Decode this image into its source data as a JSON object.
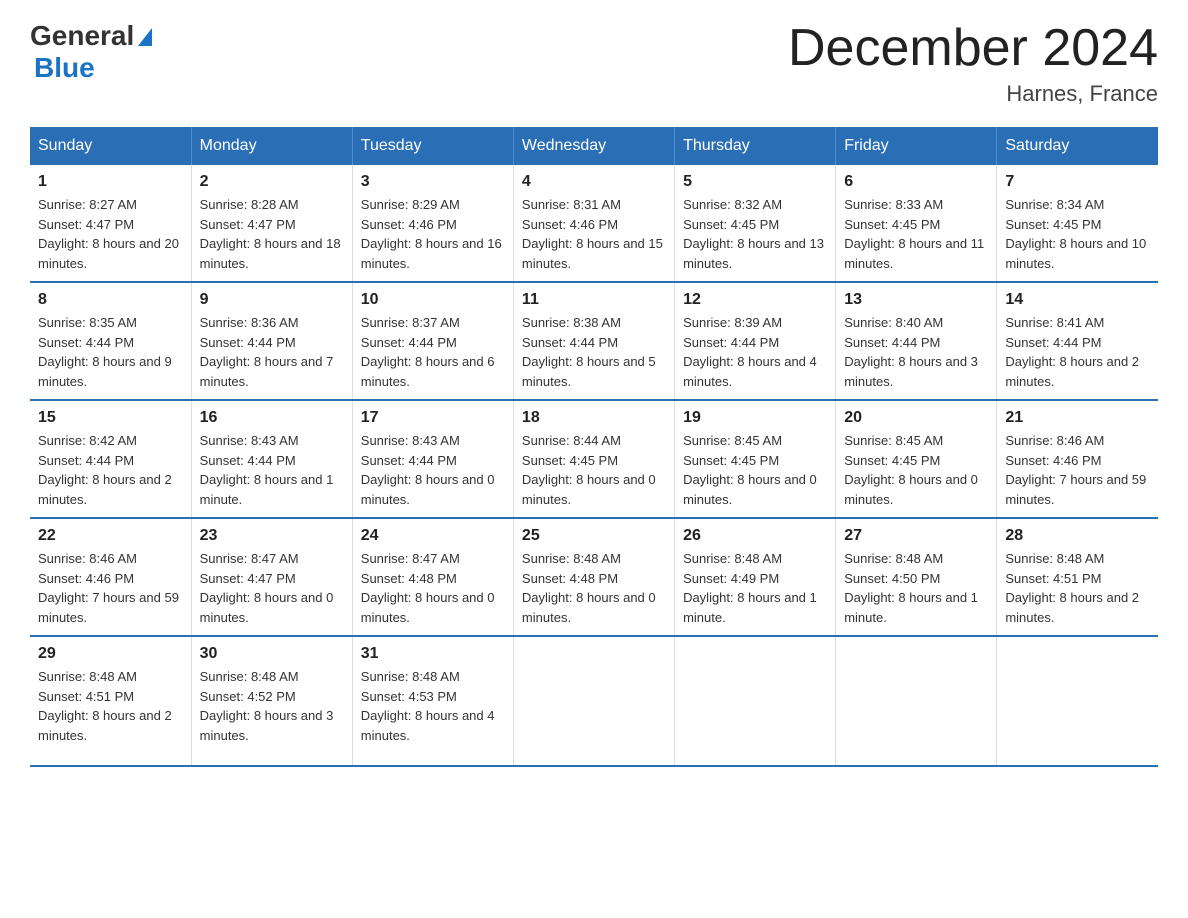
{
  "logo": {
    "general": "General",
    "blue": "Blue"
  },
  "title": "December 2024",
  "subtitle": "Harnes, France",
  "days_of_week": [
    "Sunday",
    "Monday",
    "Tuesday",
    "Wednesday",
    "Thursday",
    "Friday",
    "Saturday"
  ],
  "weeks": [
    [
      {
        "day": "1",
        "sunrise": "8:27 AM",
        "sunset": "4:47 PM",
        "daylight": "8 hours and 20 minutes."
      },
      {
        "day": "2",
        "sunrise": "8:28 AM",
        "sunset": "4:47 PM",
        "daylight": "8 hours and 18 minutes."
      },
      {
        "day": "3",
        "sunrise": "8:29 AM",
        "sunset": "4:46 PM",
        "daylight": "8 hours and 16 minutes."
      },
      {
        "day": "4",
        "sunrise": "8:31 AM",
        "sunset": "4:46 PM",
        "daylight": "8 hours and 15 minutes."
      },
      {
        "day": "5",
        "sunrise": "8:32 AM",
        "sunset": "4:45 PM",
        "daylight": "8 hours and 13 minutes."
      },
      {
        "day": "6",
        "sunrise": "8:33 AM",
        "sunset": "4:45 PM",
        "daylight": "8 hours and 11 minutes."
      },
      {
        "day": "7",
        "sunrise": "8:34 AM",
        "sunset": "4:45 PM",
        "daylight": "8 hours and 10 minutes."
      }
    ],
    [
      {
        "day": "8",
        "sunrise": "8:35 AM",
        "sunset": "4:44 PM",
        "daylight": "8 hours and 9 minutes."
      },
      {
        "day": "9",
        "sunrise": "8:36 AM",
        "sunset": "4:44 PM",
        "daylight": "8 hours and 7 minutes."
      },
      {
        "day": "10",
        "sunrise": "8:37 AM",
        "sunset": "4:44 PM",
        "daylight": "8 hours and 6 minutes."
      },
      {
        "day": "11",
        "sunrise": "8:38 AM",
        "sunset": "4:44 PM",
        "daylight": "8 hours and 5 minutes."
      },
      {
        "day": "12",
        "sunrise": "8:39 AM",
        "sunset": "4:44 PM",
        "daylight": "8 hours and 4 minutes."
      },
      {
        "day": "13",
        "sunrise": "8:40 AM",
        "sunset": "4:44 PM",
        "daylight": "8 hours and 3 minutes."
      },
      {
        "day": "14",
        "sunrise": "8:41 AM",
        "sunset": "4:44 PM",
        "daylight": "8 hours and 2 minutes."
      }
    ],
    [
      {
        "day": "15",
        "sunrise": "8:42 AM",
        "sunset": "4:44 PM",
        "daylight": "8 hours and 2 minutes."
      },
      {
        "day": "16",
        "sunrise": "8:43 AM",
        "sunset": "4:44 PM",
        "daylight": "8 hours and 1 minute."
      },
      {
        "day": "17",
        "sunrise": "8:43 AM",
        "sunset": "4:44 PM",
        "daylight": "8 hours and 0 minutes."
      },
      {
        "day": "18",
        "sunrise": "8:44 AM",
        "sunset": "4:45 PM",
        "daylight": "8 hours and 0 minutes."
      },
      {
        "day": "19",
        "sunrise": "8:45 AM",
        "sunset": "4:45 PM",
        "daylight": "8 hours and 0 minutes."
      },
      {
        "day": "20",
        "sunrise": "8:45 AM",
        "sunset": "4:45 PM",
        "daylight": "8 hours and 0 minutes."
      },
      {
        "day": "21",
        "sunrise": "8:46 AM",
        "sunset": "4:46 PM",
        "daylight": "7 hours and 59 minutes."
      }
    ],
    [
      {
        "day": "22",
        "sunrise": "8:46 AM",
        "sunset": "4:46 PM",
        "daylight": "7 hours and 59 minutes."
      },
      {
        "day": "23",
        "sunrise": "8:47 AM",
        "sunset": "4:47 PM",
        "daylight": "8 hours and 0 minutes."
      },
      {
        "day": "24",
        "sunrise": "8:47 AM",
        "sunset": "4:48 PM",
        "daylight": "8 hours and 0 minutes."
      },
      {
        "day": "25",
        "sunrise": "8:48 AM",
        "sunset": "4:48 PM",
        "daylight": "8 hours and 0 minutes."
      },
      {
        "day": "26",
        "sunrise": "8:48 AM",
        "sunset": "4:49 PM",
        "daylight": "8 hours and 1 minute."
      },
      {
        "day": "27",
        "sunrise": "8:48 AM",
        "sunset": "4:50 PM",
        "daylight": "8 hours and 1 minute."
      },
      {
        "day": "28",
        "sunrise": "8:48 AM",
        "sunset": "4:51 PM",
        "daylight": "8 hours and 2 minutes."
      }
    ],
    [
      {
        "day": "29",
        "sunrise": "8:48 AM",
        "sunset": "4:51 PM",
        "daylight": "8 hours and 2 minutes."
      },
      {
        "day": "30",
        "sunrise": "8:48 AM",
        "sunset": "4:52 PM",
        "daylight": "8 hours and 3 minutes."
      },
      {
        "day": "31",
        "sunrise": "8:48 AM",
        "sunset": "4:53 PM",
        "daylight": "8 hours and 4 minutes."
      },
      null,
      null,
      null,
      null
    ]
  ]
}
